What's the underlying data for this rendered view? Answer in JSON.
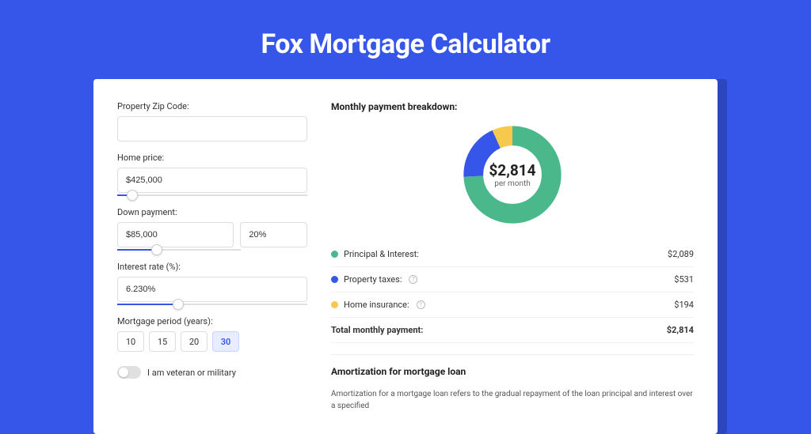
{
  "page": {
    "title": "Fox Mortgage Calculator"
  },
  "form": {
    "zip_label": "Property Zip Code:",
    "zip_value": "",
    "home_price_label": "Home price:",
    "home_price_value": "$425,000",
    "down_payment_label": "Down payment:",
    "down_payment_value": "$85,000",
    "down_payment_pct": "20%",
    "interest_label": "Interest rate (%):",
    "interest_value": "6.230%",
    "period_label": "Mortgage period (years):",
    "period_options": [
      "10",
      "15",
      "20",
      "30"
    ],
    "period_selected": "30",
    "veteran_label": "I am veteran or military",
    "veteran_checked": false,
    "sliders": {
      "home_price_pct": 8,
      "down_payment_pct": 22,
      "interest_pct": 32
    }
  },
  "breakdown": {
    "title": "Monthly payment breakdown:",
    "center_amount": "$2,814",
    "center_sub": "per month",
    "rows": [
      {
        "label": "Principal & Interest:",
        "value": "$2,089",
        "color": "#4ab88a",
        "info": false
      },
      {
        "label": "Property taxes:",
        "value": "$531",
        "color": "#3656ea",
        "info": true
      },
      {
        "label": "Home insurance:",
        "value": "$194",
        "color": "#f4c94e",
        "info": true
      }
    ],
    "total_label": "Total monthly payment:",
    "total_value": "$2,814"
  },
  "amortization": {
    "title": "Amortization for mortgage loan",
    "text": "Amortization for a mortgage loan refers to the gradual repayment of the loan principal and interest over a specified"
  },
  "colors": {
    "principal": "#4ab88a",
    "taxes": "#3656ea",
    "insurance": "#f4c94e"
  },
  "chart_data": {
    "type": "pie",
    "title": "Monthly payment breakdown",
    "series": [
      {
        "name": "Principal & Interest",
        "value": 2089,
        "color": "#4ab88a"
      },
      {
        "name": "Property taxes",
        "value": 531,
        "color": "#3656ea"
      },
      {
        "name": "Home insurance",
        "value": 194,
        "color": "#f4c94e"
      }
    ],
    "total": 2814
  }
}
